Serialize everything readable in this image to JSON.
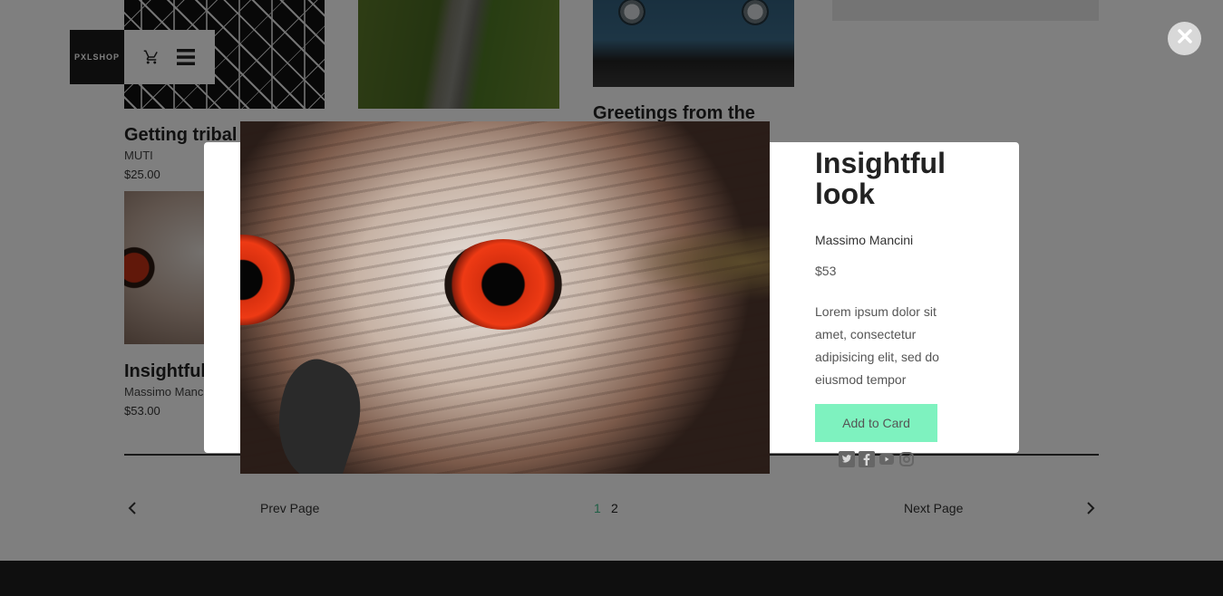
{
  "brand": {
    "logo_text": "PXLSHOP"
  },
  "nav": {
    "cart_icon": "cart-icon",
    "menu_icon": "hamburger-menu-icon"
  },
  "tiles": [
    {
      "title": "Getting tribal",
      "author": "MUTI",
      "price": "$25.00"
    },
    {
      "title": "Greetings from the"
    },
    {
      "title": "Insightful look",
      "author": "Massimo Mancini",
      "price": "$53.00"
    }
  ],
  "pagination": {
    "prev_label": "Prev Page",
    "next_label": "Next Page",
    "pages": [
      "1",
      "2"
    ],
    "current": "1"
  },
  "modal": {
    "title": "Insightful look",
    "author": "Massimo Mancini",
    "price": "$53",
    "description": "Lorem ipsum dolor sit amet, consectetur adipisicing elit, sed do eiusmod tempor",
    "add_button_label": "Add to Card",
    "social": [
      "twitter-icon",
      "facebook-icon",
      "youtube-icon",
      "instagram-icon"
    ]
  },
  "colors": {
    "accent": "#7ef2bf",
    "page_active": "#3fbf8a",
    "footer": "#1e1e1e",
    "overlay": "rgba(0,0,0,0.5)"
  }
}
